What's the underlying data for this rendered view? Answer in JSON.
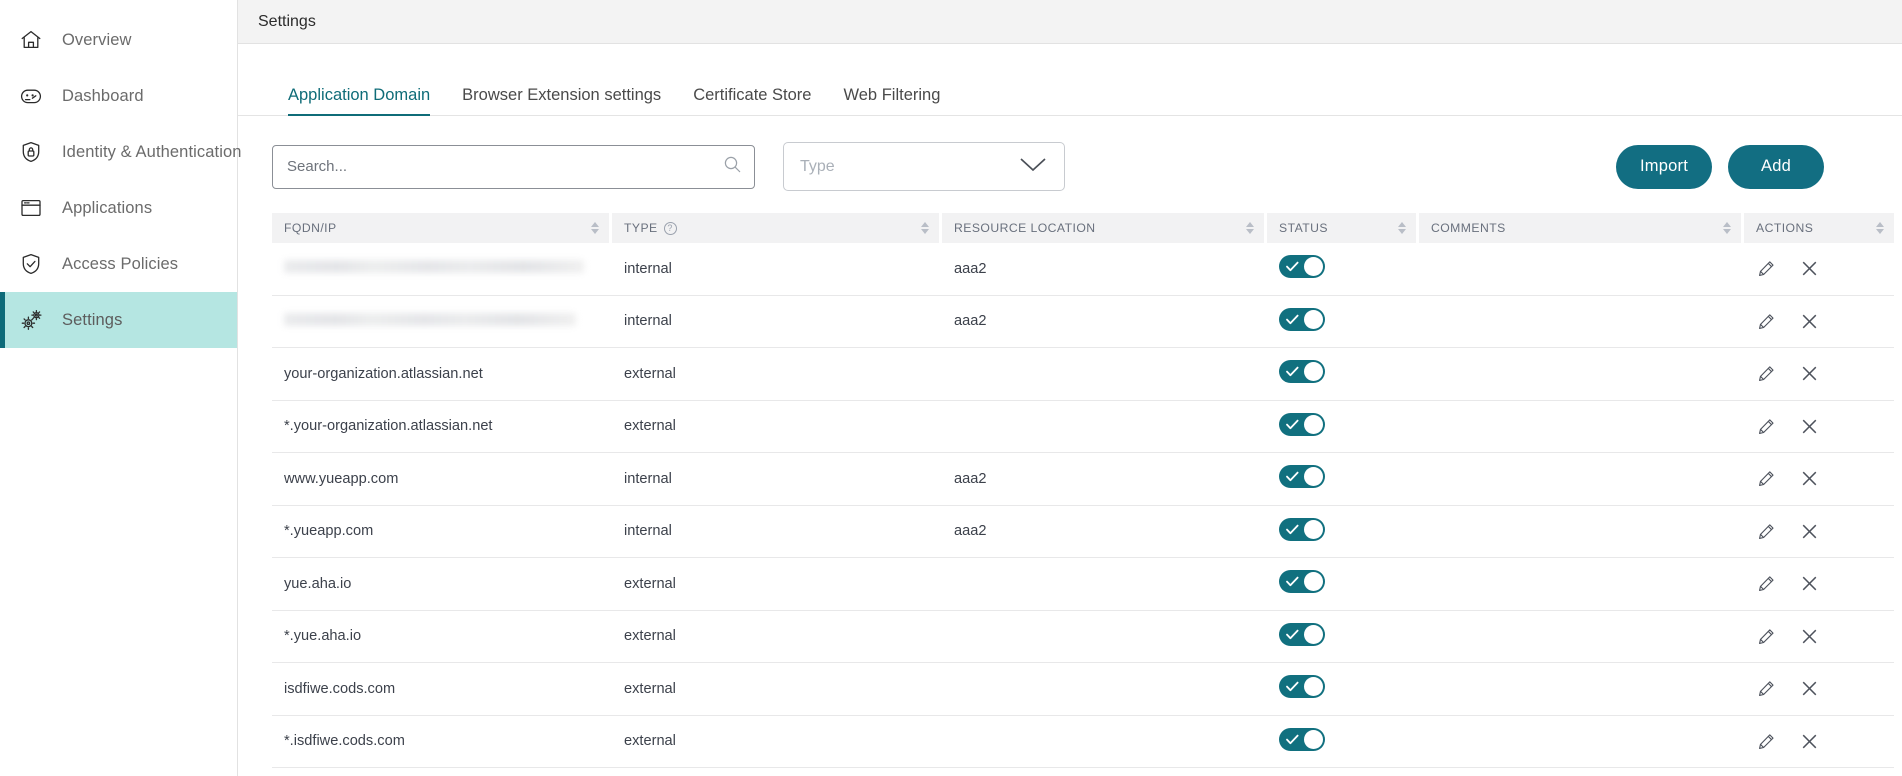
{
  "sidebar": {
    "items": [
      {
        "label": "Overview",
        "icon": "home-icon",
        "active": false
      },
      {
        "label": "Dashboard",
        "icon": "gauge-icon",
        "active": false
      },
      {
        "label": "Identity & Authentication",
        "icon": "shield-lock-icon",
        "active": false
      },
      {
        "label": "Applications",
        "icon": "window-icon",
        "active": false
      },
      {
        "label": "Access Policies",
        "icon": "shield-check-icon",
        "active": false
      },
      {
        "label": "Settings",
        "icon": "gears-icon",
        "active": true
      }
    ]
  },
  "topbar": {
    "title": "Settings"
  },
  "tabs": [
    {
      "label": "Application Domain",
      "active": true
    },
    {
      "label": "Browser Extension settings",
      "active": false
    },
    {
      "label": "Certificate Store",
      "active": false
    },
    {
      "label": "Web Filtering",
      "active": false
    }
  ],
  "filters": {
    "search_placeholder": "Search...",
    "search_value": "",
    "search_icon": "search-icon",
    "type_label": "Type",
    "type_value": "",
    "chevron_icon": "chevron-down-icon"
  },
  "buttons": {
    "import_label": "Import",
    "add_label": "Add"
  },
  "table": {
    "columns": [
      {
        "label": "FQDN/IP",
        "sortable": true,
        "help": false
      },
      {
        "label": "TYPE",
        "sortable": true,
        "help": true
      },
      {
        "label": "RESOURCE LOCATION",
        "sortable": true,
        "help": false
      },
      {
        "label": "STATUS",
        "sortable": true,
        "help": false
      },
      {
        "label": "COMMENTS",
        "sortable": true,
        "help": false
      },
      {
        "label": "ACTIONS",
        "sortable": true,
        "help": false
      }
    ],
    "rows": [
      {
        "fqdn": "",
        "redacted": true,
        "type": "internal",
        "resource_location": "aaa2",
        "status": true,
        "comments": "",
        "edit_icon": "pencil-icon",
        "delete_icon": "close-icon"
      },
      {
        "fqdn": "",
        "redacted": true,
        "type": "internal",
        "resource_location": "aaa2",
        "status": true,
        "comments": "",
        "edit_icon": "pencil-icon",
        "delete_icon": "close-icon"
      },
      {
        "fqdn": "your-organization.atlassian.net",
        "redacted": false,
        "type": "external",
        "resource_location": "",
        "status": true,
        "comments": "",
        "edit_icon": "pencil-icon",
        "delete_icon": "close-icon"
      },
      {
        "fqdn": "*.your-organization.atlassian.net",
        "redacted": false,
        "type": "external",
        "resource_location": "",
        "status": true,
        "comments": "",
        "edit_icon": "pencil-icon",
        "delete_icon": "close-icon"
      },
      {
        "fqdn": "www.yueapp.com",
        "redacted": false,
        "type": "internal",
        "resource_location": "aaa2",
        "status": true,
        "comments": "",
        "edit_icon": "pencil-icon",
        "delete_icon": "close-icon"
      },
      {
        "fqdn": "*.yueapp.com",
        "redacted": false,
        "type": "internal",
        "resource_location": "aaa2",
        "status": true,
        "comments": "",
        "edit_icon": "pencil-icon",
        "delete_icon": "close-icon"
      },
      {
        "fqdn": "yue.aha.io",
        "redacted": false,
        "type": "external",
        "resource_location": "",
        "status": true,
        "comments": "",
        "edit_icon": "pencil-icon",
        "delete_icon": "close-icon"
      },
      {
        "fqdn": "*.yue.aha.io",
        "redacted": false,
        "type": "external",
        "resource_location": "",
        "status": true,
        "comments": "",
        "edit_icon": "pencil-icon",
        "delete_icon": "close-icon"
      },
      {
        "fqdn": "isdfiwe.cods.com",
        "redacted": false,
        "type": "external",
        "resource_location": "",
        "status": true,
        "comments": "",
        "edit_icon": "pencil-icon",
        "delete_icon": "close-icon"
      },
      {
        "fqdn": "*.isdfiwe.cods.com",
        "redacted": false,
        "type": "external",
        "resource_location": "",
        "status": true,
        "comments": "",
        "edit_icon": "pencil-icon",
        "delete_icon": "close-icon"
      }
    ]
  },
  "colors": {
    "accent_teal": "#126e82",
    "active_nav_bg": "#b5e6e2",
    "active_nav_bar": "#0d6b79",
    "topbar_bg": "#f3f3f3",
    "table_header_bg": "#f2f2f3",
    "toggle_on": "#11707f"
  }
}
